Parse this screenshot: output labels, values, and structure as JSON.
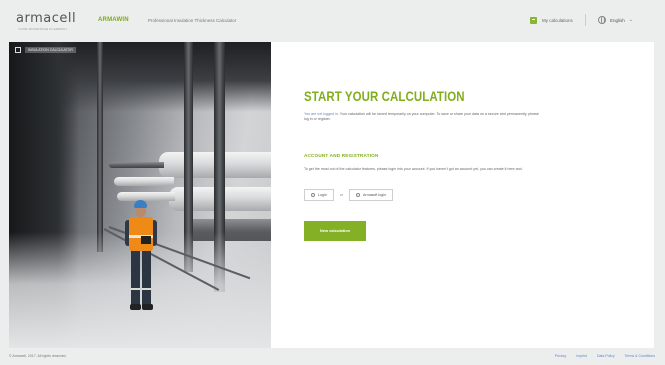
{
  "header": {
    "logo": "armacell",
    "logo_tagline": "YOUR ADVANTAGE IN ENERGY",
    "product": "ARMAWIN",
    "subtitle": "Professional Insulation Thickness Calculator",
    "my_calculations": "My calculations",
    "language": "English",
    "colors": {
      "accent": "#82ae1e",
      "link": "#5d89c9"
    }
  },
  "photo": {
    "caption": "INSULATION CALCULATOR"
  },
  "main": {
    "title": "START YOUR CALCULATION",
    "intro_link": "You are not logged in.",
    "intro_text": "Your calculation will be stored temporarily on your computer. To save or share your data on a secure and permanently, please log in or register.",
    "section_title": "ACCOUNT AND REGISTRATION",
    "section_text": "To get the most out of the calculator features, please login into your account. If you haven't got an account yet, you can create it here and.",
    "login_label": "Login",
    "or_label": "or",
    "armasoft_login_label": "Armasoft login",
    "new_calc_label": "New calculation"
  },
  "footer": {
    "copyright": "© Armacell, 2017. All rights reserved.",
    "links": [
      "Privacy",
      "Imprint",
      "Data Policy",
      "Terms & Conditions"
    ]
  }
}
